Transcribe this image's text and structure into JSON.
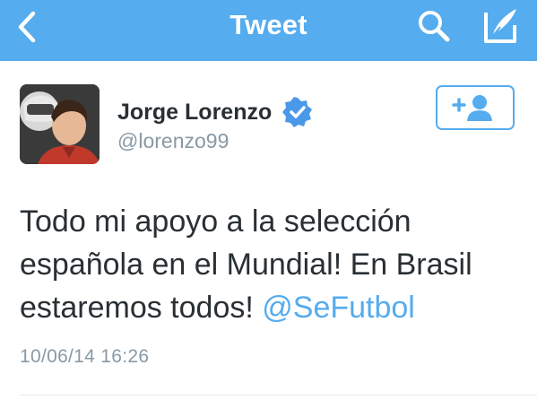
{
  "navbar": {
    "title": "Tweet",
    "back_icon": "chevron-left-icon",
    "search_icon": "search-icon",
    "compose_icon": "compose-icon"
  },
  "tweet": {
    "author": {
      "display_name": "Jorge Lorenzo",
      "handle": "@lorenzo99",
      "verified": true,
      "avatar_icon": "profile-photo"
    },
    "follow_button_icon": "add-user-icon",
    "text_lines": [
      "Todo mi apoyo a la selección",
      "española en el Mundial! En Brasil",
      "estaremos todos! "
    ],
    "mention": "@SeFutbol",
    "timestamp": "10/06/14 16:26"
  },
  "colors": {
    "brand_blue": "#55acee",
    "text_dark": "#292f33",
    "text_muted": "#8899a6",
    "verified_blue": "#4a99e9"
  }
}
